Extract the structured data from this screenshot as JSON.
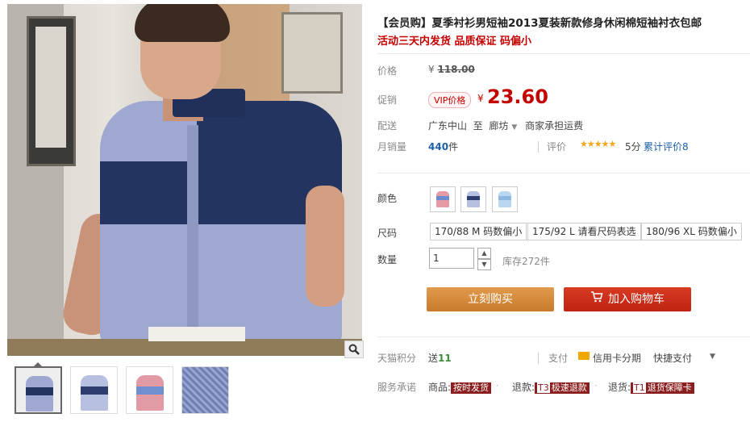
{
  "product": {
    "title": "【会员购】夏季衬衫男短袖2013夏装新款修身休闲棉短袖衬衣包邮",
    "subtitle": "活动三天内发货 品质保证 码偏小"
  },
  "price": {
    "label": "价格",
    "currency": "¥",
    "original": "118.00"
  },
  "promo": {
    "label": "促销",
    "badge": "VIP价格",
    "currency": "¥",
    "price": "23.60"
  },
  "shipping": {
    "label": "配送",
    "from": "广东中山",
    "to_word": "至",
    "destination": "廊坊",
    "note": "商家承担运费"
  },
  "sales": {
    "label": "月销量",
    "count": "440",
    "unit": "件"
  },
  "review": {
    "label": "评价",
    "stars": "★★★★★",
    "score": "5分",
    "total": "累计评价8",
    "rating": 5
  },
  "color": {
    "label": "颜色",
    "options": [
      "pink-blue-shirt",
      "blue-navy-shirt",
      "light-blue-shirt"
    ]
  },
  "size": {
    "label": "尺码",
    "options": [
      "170/88 M 码数偏小",
      "175/92 L 请看尺码表选",
      "180/96 XL 码数偏小"
    ]
  },
  "quantity": {
    "label": "数量",
    "value": "1",
    "stock": "库存272件"
  },
  "actions": {
    "buy_now": "立刻购买",
    "add_to_cart": "加入购物车"
  },
  "points": {
    "label": "天猫积分",
    "prefix": "送",
    "value": "11"
  },
  "payment": {
    "label": "支付",
    "card": "信用卡分期",
    "fast": "快捷支付"
  },
  "service": {
    "label": "服务承诺",
    "items": [
      {
        "prefix": "商品:",
        "tag": "按时发货"
      },
      {
        "prefix": "退款:",
        "code": "T3",
        "tag": "极速退款"
      },
      {
        "prefix": "退货:",
        "code": "T1",
        "tag": "退货保障卡"
      }
    ]
  },
  "colors": {
    "price_red": "#c40000",
    "buy_orange": "#d58a3c",
    "cart_red": "#c92a16",
    "link_blue": "#1c5fa8",
    "star_orange": "#f3a51b"
  }
}
